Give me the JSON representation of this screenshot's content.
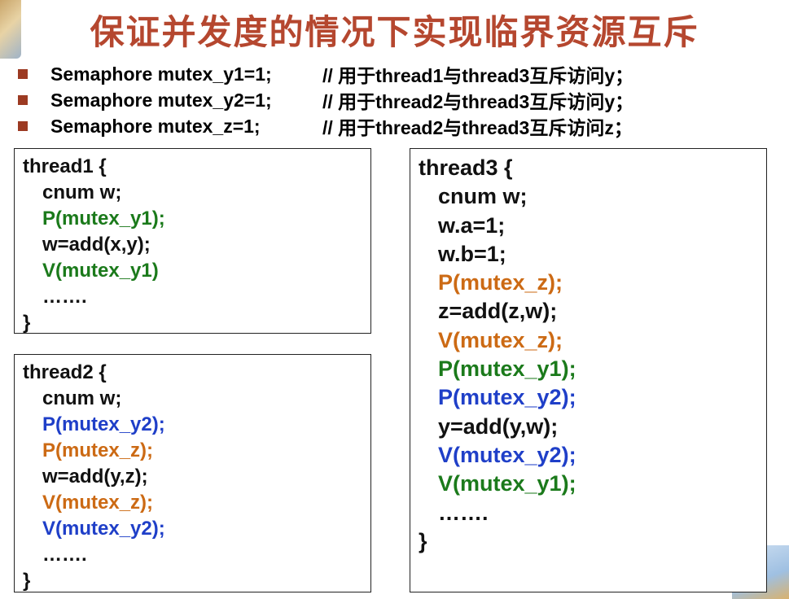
{
  "title": "保证并发度的情况下实现临界资源互斥",
  "declarations": [
    {
      "decl": "Semaphore mutex_y1=1;",
      "comment": "// 用于thread1与thread3互斥访问y；"
    },
    {
      "decl": "Semaphore mutex_y2=1;",
      "comment": "// 用于thread2与thread3互斥访问y；"
    },
    {
      "decl": "Semaphore mutex_z=1;",
      "comment": "// 用于thread2与thread3互斥访问z；"
    }
  ],
  "thread1": [
    "thread1 {",
    "cnum w;",
    "P(mutex_y1);",
    "w=add(x,y);",
    "V(mutex_y1)",
    "…….",
    "}"
  ],
  "thread2": [
    "thread2 {",
    "cnum w;",
    "P(mutex_y2);",
    "P(mutex_z);",
    "w=add(y,z);",
    "V(mutex_z);",
    "V(mutex_y2);",
    "…….",
    "}"
  ],
  "thread3": [
    "thread3 {",
    "cnum w;",
    "w.a=1;",
    "w.b=1;",
    "P(mutex_z);",
    "z=add(z,w);",
    "V(mutex_z);",
    "P(mutex_y1);",
    "P(mutex_y2);",
    "y=add(y,w);",
    "V(mutex_y2);",
    "V(mutex_y1);",
    "…….",
    "}"
  ],
  "colors": {
    "title": "#b5472f",
    "bullet": "#9c3a22",
    "mutex_y1": "#1b7a1b",
    "mutex_y2": "#1f3fc8",
    "mutex_z": "#cc6a14"
  }
}
